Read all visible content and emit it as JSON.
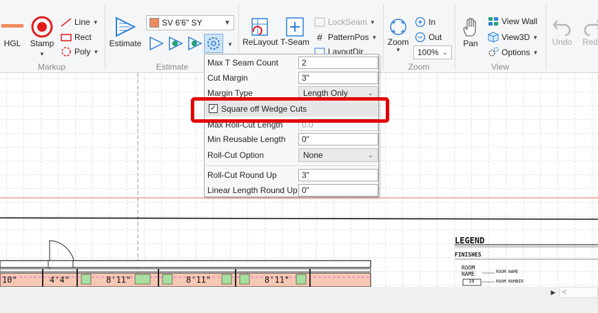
{
  "ribbon": {
    "markup": {
      "group_label": "Markup",
      "hgl_label": "HGL",
      "stamp_label": "Stamp",
      "line_label": "Line",
      "rect_label": "Rect",
      "poly_label": "Poly"
    },
    "estimate": {
      "group_label": "Estimate",
      "estimate_label": "Estimate",
      "product_value": "SV 6'6\" SY",
      "product_color": "#f08a5d"
    },
    "layout": {
      "relayout_label": "ReLayout",
      "tseam_label": "T-Seam",
      "lockseam_label": "LockSeam",
      "patternpos_label": "PatternPos",
      "layoutdir_label": "LayoutDir"
    },
    "zoom": {
      "group_label": "Zoom",
      "zoom_label": "Zoom",
      "in_label": "In",
      "out_label": "Out",
      "zoom_value": "100%"
    },
    "view": {
      "group_label": "View",
      "pan_label": "Pan",
      "view_wall_label": "View Wall",
      "view3d_label": "View3D",
      "options_label": "Options"
    },
    "edit": {
      "undo_label": "Undo",
      "redo_label": "Redo"
    }
  },
  "settings_panel": {
    "max_t_seam_count": {
      "label": "Max T Seam Count",
      "value": "2"
    },
    "cut_margin": {
      "label": "Cut Margin",
      "value": "3\""
    },
    "margin_type": {
      "label": "Margin Type",
      "value": "Length Only"
    },
    "square_off": {
      "label": "Square off Wedge Cuts",
      "checked": true
    },
    "max_roll_cut": {
      "label": "Max Roll-Cut Length",
      "value": "0.0"
    },
    "min_reusable": {
      "label": "Min Reusable Length",
      "value": "0\""
    },
    "roll_cut_option": {
      "label": "Roll-Cut Option",
      "value": "None"
    },
    "roll_cut_round_up": {
      "label": "Roll-Cut Round Up",
      "value": "3\""
    },
    "linear_length_round_up": {
      "label": "Linear Length Round Up",
      "value": "0\""
    }
  },
  "drawing": {
    "rooms": [
      "10\"",
      "4'4\"",
      "8'11\"",
      "8'11\"",
      "8'11\""
    ],
    "legend_title": "LEGEND",
    "finishes_label": "FINISHES",
    "room_label": "ROOM",
    "name_label": "NAME",
    "room_num": "10",
    "room_name_caption": "ROOM NAME",
    "room_number_caption": "ROOM NUMBER"
  },
  "colors": {
    "highlight": "#e30000",
    "accent_blue": "#2b7fd4",
    "room_fill": "#f6c8b4"
  }
}
